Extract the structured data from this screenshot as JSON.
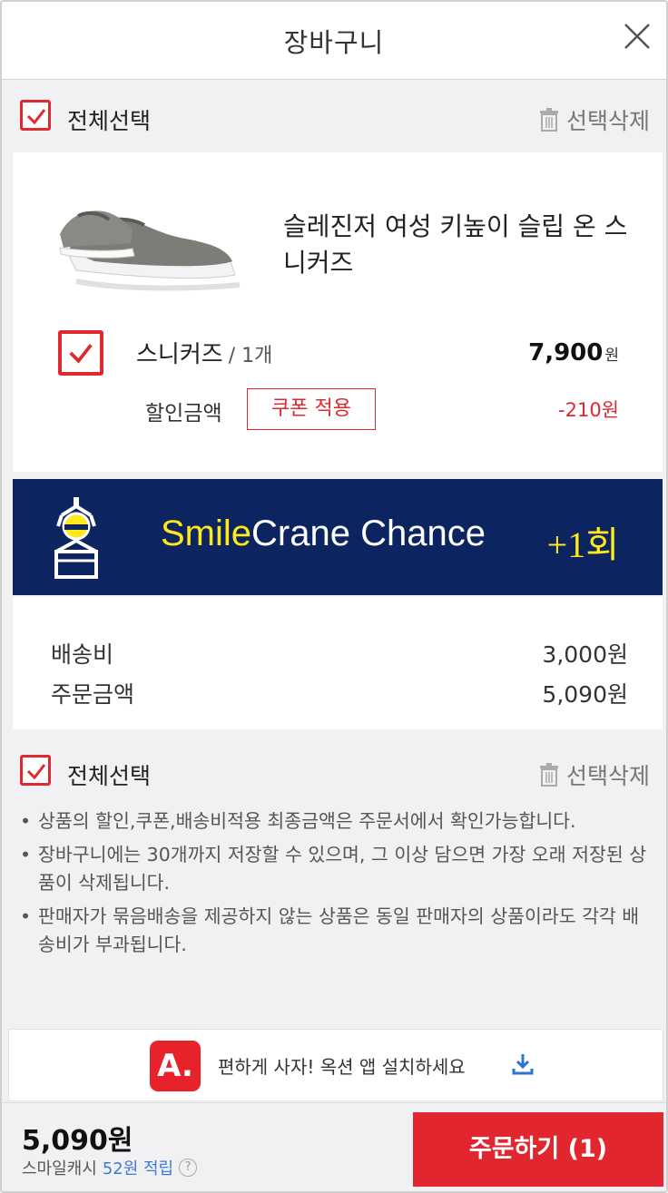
{
  "header": {
    "title": "장바구니"
  },
  "select_all": {
    "label": "전체선택",
    "delete_label": "선택삭제"
  },
  "product": {
    "name": "슬레진저 여성 키높이 슬립 온 스니커즈",
    "option_name": "스니커즈",
    "quantity": "/ 1개",
    "price": "7,900",
    "price_unit": "원",
    "discount_label": "할인금액",
    "coupon_button": "쿠폰 적용",
    "discount_value": "-210원"
  },
  "banner": {
    "text_smile": "Smile",
    "text_rest": "Crane Chance",
    "bonus": "+1회",
    "bg_color": "#0c2460",
    "accent_color": "#ffe91a"
  },
  "summary": {
    "shipping_label": "배송비",
    "shipping_value": "3,000원",
    "order_label": "주문금액",
    "order_value": "5,090원"
  },
  "notes": [
    "상품의 할인,쿠폰,배송비적용 최종금액은 주문서에서 확인가능합니다.",
    "장바구니에는 30개까지 저장할 수 있으며, 그 이상 담으면 가장 오래 저장된 상품이 삭제됩니다.",
    "판매자가 묶음배송을 제공하지 않는 상품은 동일 판매자의 상품이라도 각각 배송비가 부과됩니다."
  ],
  "app_bar": {
    "logo": "A.",
    "text": "편하게 사자! 옥션 앱 설치하세요"
  },
  "bottom": {
    "total": "5,090원",
    "cash_label": "스마일캐시",
    "cash_amount": "52원 적립",
    "help": "?",
    "order_button": "주문하기 (1)"
  },
  "colors": {
    "accent": "#e2262f",
    "link": "#3d7ad8"
  },
  "icons": [
    "close-icon",
    "checkbox-checked-icon",
    "trash-icon",
    "crane-icon",
    "download-icon",
    "help-icon"
  ]
}
